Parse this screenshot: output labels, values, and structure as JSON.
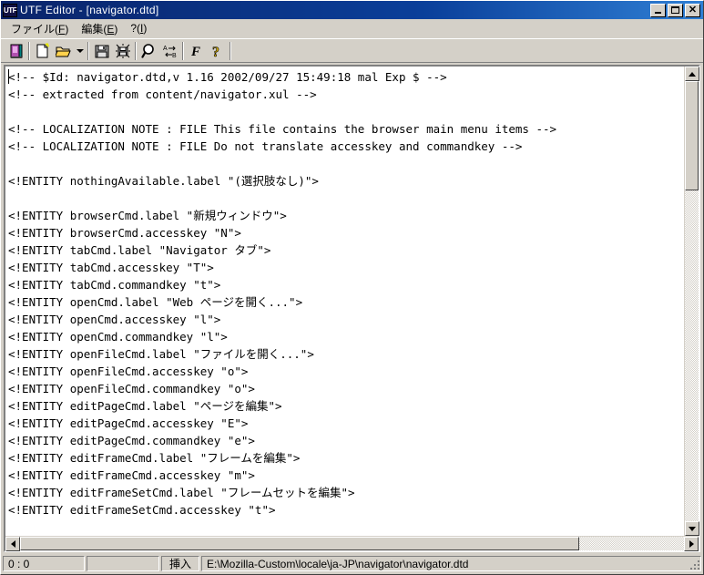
{
  "window": {
    "icon_label": "UTF",
    "title": "UTF Editor - [navigator.dtd]",
    "buttons": {
      "minimize": "_",
      "maximize": "□",
      "close": "✕"
    }
  },
  "menubar": {
    "items": [
      {
        "name": "file",
        "label_pre": "ファイル(",
        "accesskey": "F",
        "label_post": ")"
      },
      {
        "name": "edit",
        "label_pre": "編集(",
        "accesskey": "E",
        "label_post": ")"
      },
      {
        "name": "help",
        "label_pre": "?(",
        "accesskey": "I",
        "label_post": ")"
      }
    ]
  },
  "toolbar": {
    "buttons": [
      {
        "name": "exit-icon",
        "tip": "終了"
      },
      {
        "name": "new-file-icon",
        "tip": "新規"
      },
      {
        "name": "open-file-icon",
        "tip": "開く"
      },
      {
        "name": "open-recent-dropdown-icon",
        "tip": "履歴"
      },
      {
        "name": "save-icon",
        "tip": "保存"
      },
      {
        "name": "save-as-icon",
        "tip": "名前を付けて保存"
      },
      {
        "name": "search-icon",
        "tip": "検索"
      },
      {
        "name": "replace-icon",
        "tip": "置換"
      },
      {
        "name": "font-icon",
        "tip": "フォント"
      },
      {
        "name": "help-icon",
        "tip": "ヘルプ"
      }
    ]
  },
  "editor": {
    "lines": [
      "<!-- $Id: navigator.dtd,v 1.16 2002/09/27 15:49:18 mal Exp $ -->",
      "<!-- extracted from content/navigator.xul -->",
      "",
      "<!-- LOCALIZATION NOTE : FILE This file contains the browser main menu items -->",
      "<!-- LOCALIZATION NOTE : FILE Do not translate accesskey and commandkey -->",
      "",
      "<!ENTITY nothingAvailable.label \"(選択肢なし)\">",
      "",
      "<!ENTITY browserCmd.label \"新規ウィンドウ\">",
      "<!ENTITY browserCmd.accesskey \"N\">",
      "<!ENTITY tabCmd.label \"Navigator タブ\">",
      "<!ENTITY tabCmd.accesskey \"T\">",
      "<!ENTITY tabCmd.commandkey \"t\">",
      "<!ENTITY openCmd.label \"Web ページを開く...\">",
      "<!ENTITY openCmd.accesskey \"l\">",
      "<!ENTITY openCmd.commandkey \"l\">",
      "<!ENTITY openFileCmd.label \"ファイルを開く...\">",
      "<!ENTITY openFileCmd.accesskey \"o\">",
      "<!ENTITY openFileCmd.commandkey \"o\">",
      "<!ENTITY editPageCmd.label \"ページを編集\">",
      "<!ENTITY editPageCmd.accesskey \"E\">",
      "<!ENTITY editPageCmd.commandkey \"e\">",
      "<!ENTITY editFrameCmd.label \"フレームを編集\">",
      "<!ENTITY editFrameCmd.accesskey \"m\">",
      "<!ENTITY editFrameSetCmd.label \"フレームセットを編集\">",
      "<!ENTITY editFrameSetCmd.accesskey \"t\">"
    ]
  },
  "statusbar": {
    "position": "0 : 0",
    "spare": "",
    "insert_mode": "挿入",
    "file_path": "E:\\Mozilla-Custom\\locale\\ja-JP\\navigator\\navigator.dtd"
  },
  "colors": {
    "title_active_start": "#0a246a",
    "title_active_end": "#2f7fd4",
    "face": "#d4d0c8",
    "editor_bg": "#ffffff",
    "text": "#000000"
  }
}
